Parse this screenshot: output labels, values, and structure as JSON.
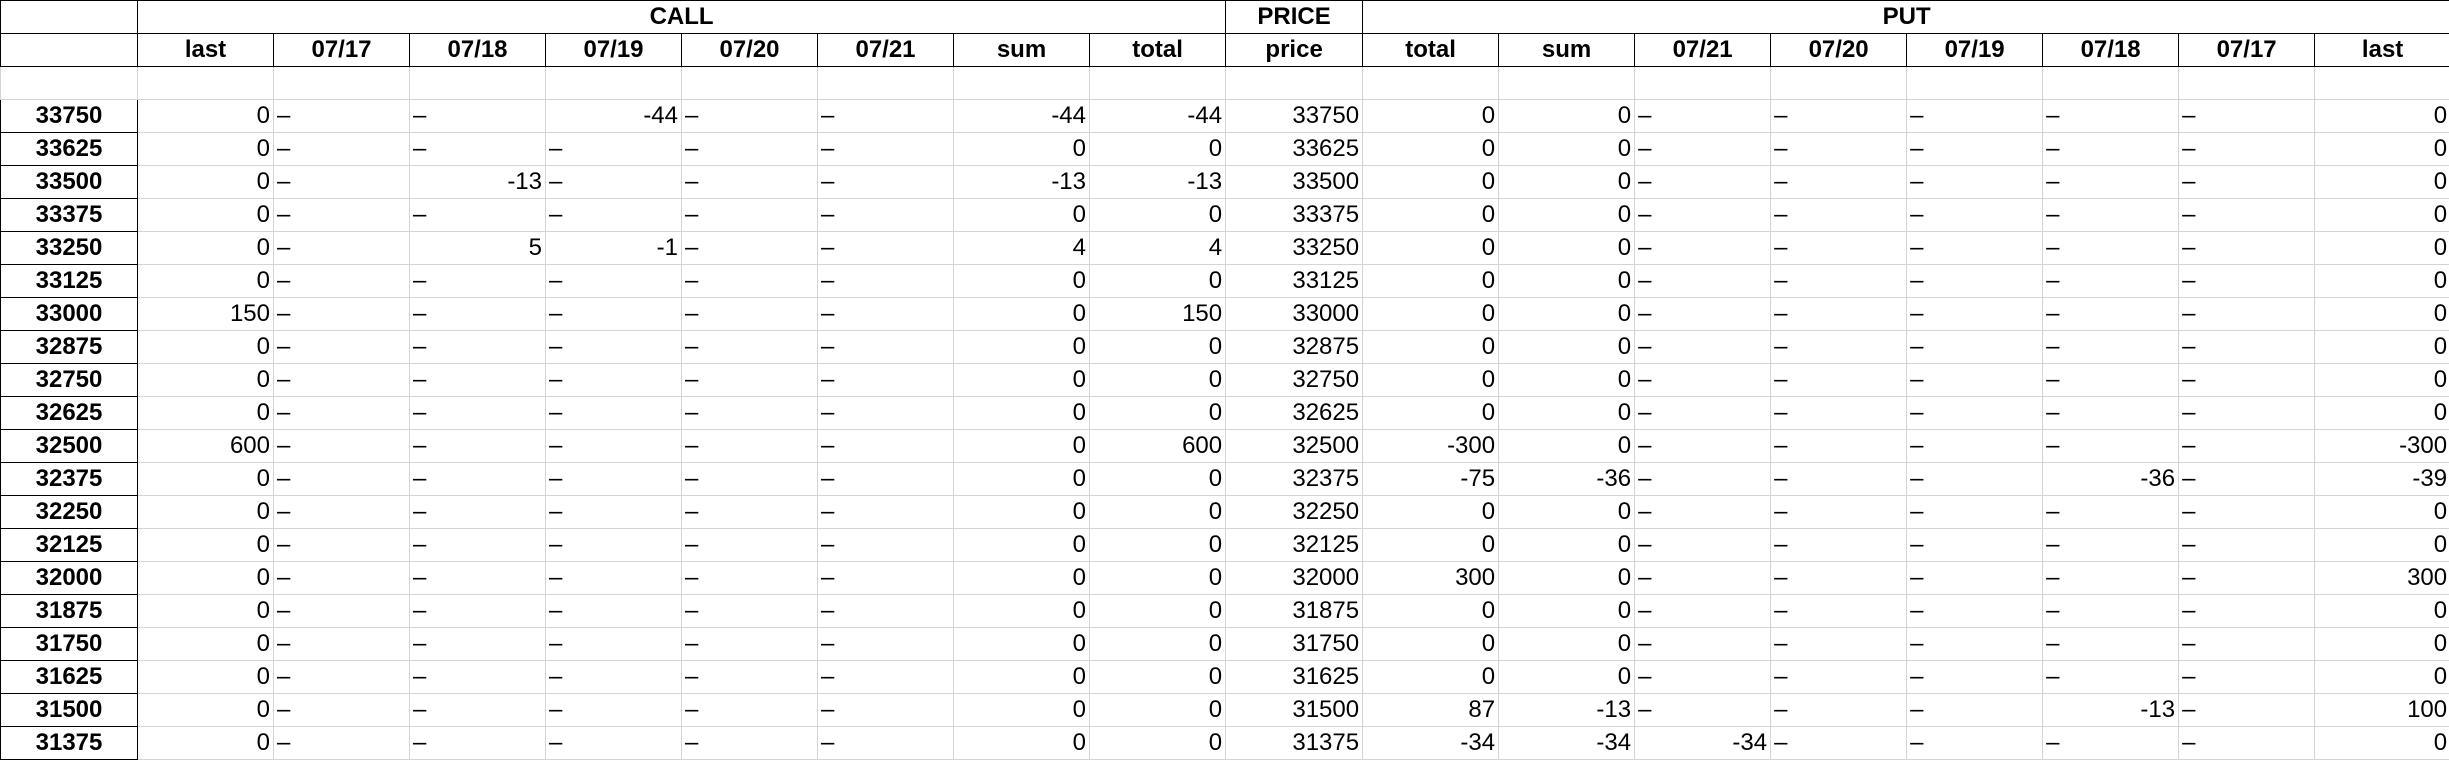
{
  "groups": {
    "call": "CALL",
    "price": "PRICE",
    "put": "PUT"
  },
  "columns": {
    "call": [
      "last",
      "07/17",
      "07/18",
      "07/19",
      "07/20",
      "07/21",
      "sum",
      "total"
    ],
    "price": "price",
    "put": [
      "total",
      "sum",
      "07/21",
      "07/20",
      "07/19",
      "07/18",
      "07/17",
      "last"
    ]
  },
  "rows": [
    {
      "label": "33750",
      "call": [
        "0",
        "–",
        "–",
        "-44",
        "–",
        "–",
        "-44",
        "-44"
      ],
      "price": "33750",
      "put": [
        "0",
        "0",
        "–",
        "–",
        "–",
        "–",
        "–",
        "0"
      ]
    },
    {
      "label": "33625",
      "call": [
        "0",
        "–",
        "–",
        "–",
        "–",
        "–",
        "0",
        "0"
      ],
      "price": "33625",
      "put": [
        "0",
        "0",
        "–",
        "–",
        "–",
        "–",
        "–",
        "0"
      ]
    },
    {
      "label": "33500",
      "call": [
        "0",
        "–",
        "-13",
        "–",
        "–",
        "–",
        "-13",
        "-13"
      ],
      "price": "33500",
      "put": [
        "0",
        "0",
        "–",
        "–",
        "–",
        "–",
        "–",
        "0"
      ]
    },
    {
      "label": "33375",
      "call": [
        "0",
        "–",
        "–",
        "–",
        "–",
        "–",
        "0",
        "0"
      ],
      "price": "33375",
      "put": [
        "0",
        "0",
        "–",
        "–",
        "–",
        "–",
        "–",
        "0"
      ]
    },
    {
      "label": "33250",
      "call": [
        "0",
        "–",
        "5",
        "-1",
        "–",
        "–",
        "4",
        "4"
      ],
      "price": "33250",
      "put": [
        "0",
        "0",
        "–",
        "–",
        "–",
        "–",
        "–",
        "0"
      ]
    },
    {
      "label": "33125",
      "call": [
        "0",
        "–",
        "–",
        "–",
        "–",
        "–",
        "0",
        "0"
      ],
      "price": "33125",
      "put": [
        "0",
        "0",
        "–",
        "–",
        "–",
        "–",
        "–",
        "0"
      ]
    },
    {
      "label": "33000",
      "call": [
        "150",
        "–",
        "–",
        "–",
        "–",
        "–",
        "0",
        "150"
      ],
      "price": "33000",
      "put": [
        "0",
        "0",
        "–",
        "–",
        "–",
        "–",
        "–",
        "0"
      ]
    },
    {
      "label": "32875",
      "call": [
        "0",
        "–",
        "–",
        "–",
        "–",
        "–",
        "0",
        "0"
      ],
      "price": "32875",
      "put": [
        "0",
        "0",
        "–",
        "–",
        "–",
        "–",
        "–",
        "0"
      ]
    },
    {
      "label": "32750",
      "call": [
        "0",
        "–",
        "–",
        "–",
        "–",
        "–",
        "0",
        "0"
      ],
      "price": "32750",
      "put": [
        "0",
        "0",
        "–",
        "–",
        "–",
        "–",
        "–",
        "0"
      ]
    },
    {
      "label": "32625",
      "call": [
        "0",
        "–",
        "–",
        "–",
        "–",
        "–",
        "0",
        "0"
      ],
      "price": "32625",
      "put": [
        "0",
        "0",
        "–",
        "–",
        "–",
        "–",
        "–",
        "0"
      ]
    },
    {
      "label": "32500",
      "call": [
        "600",
        "–",
        "–",
        "–",
        "–",
        "–",
        "0",
        "600"
      ],
      "price": "32500",
      "put": [
        "-300",
        "0",
        "–",
        "–",
        "–",
        "–",
        "–",
        "-300"
      ]
    },
    {
      "label": "32375",
      "call": [
        "0",
        "–",
        "–",
        "–",
        "–",
        "–",
        "0",
        "0"
      ],
      "price": "32375",
      "put": [
        "-75",
        "-36",
        "–",
        "–",
        "–",
        "-36",
        "–",
        "-39"
      ]
    },
    {
      "label": "32250",
      "call": [
        "0",
        "–",
        "–",
        "–",
        "–",
        "–",
        "0",
        "0"
      ],
      "price": "32250",
      "put": [
        "0",
        "0",
        "–",
        "–",
        "–",
        "–",
        "–",
        "0"
      ]
    },
    {
      "label": "32125",
      "call": [
        "0",
        "–",
        "–",
        "–",
        "–",
        "–",
        "0",
        "0"
      ],
      "price": "32125",
      "put": [
        "0",
        "0",
        "–",
        "–",
        "–",
        "–",
        "–",
        "0"
      ]
    },
    {
      "label": "32000",
      "call": [
        "0",
        "–",
        "–",
        "–",
        "–",
        "–",
        "0",
        "0"
      ],
      "price": "32000",
      "put": [
        "300",
        "0",
        "–",
        "–",
        "–",
        "–",
        "–",
        "300"
      ]
    },
    {
      "label": "31875",
      "call": [
        "0",
        "–",
        "–",
        "–",
        "–",
        "–",
        "0",
        "0"
      ],
      "price": "31875",
      "put": [
        "0",
        "0",
        "–",
        "–",
        "–",
        "–",
        "–",
        "0"
      ]
    },
    {
      "label": "31750",
      "call": [
        "0",
        "–",
        "–",
        "–",
        "–",
        "–",
        "0",
        "0"
      ],
      "price": "31750",
      "put": [
        "0",
        "0",
        "–",
        "–",
        "–",
        "–",
        "–",
        "0"
      ]
    },
    {
      "label": "31625",
      "call": [
        "0",
        "–",
        "–",
        "–",
        "–",
        "–",
        "0",
        "0"
      ],
      "price": "31625",
      "put": [
        "0",
        "0",
        "–",
        "–",
        "–",
        "–",
        "–",
        "0"
      ]
    },
    {
      "label": "31500",
      "call": [
        "0",
        "–",
        "–",
        "–",
        "–",
        "–",
        "0",
        "0"
      ],
      "price": "31500",
      "put": [
        "87",
        "-13",
        "–",
        "–",
        "–",
        "-13",
        "–",
        "100"
      ]
    },
    {
      "label": "31375",
      "call": [
        "0",
        "–",
        "–",
        "–",
        "–",
        "–",
        "0",
        "0"
      ],
      "price": "31375",
      "put": [
        "-34",
        "-34",
        "-34",
        "–",
        "–",
        "–",
        "–",
        "0"
      ]
    }
  ]
}
